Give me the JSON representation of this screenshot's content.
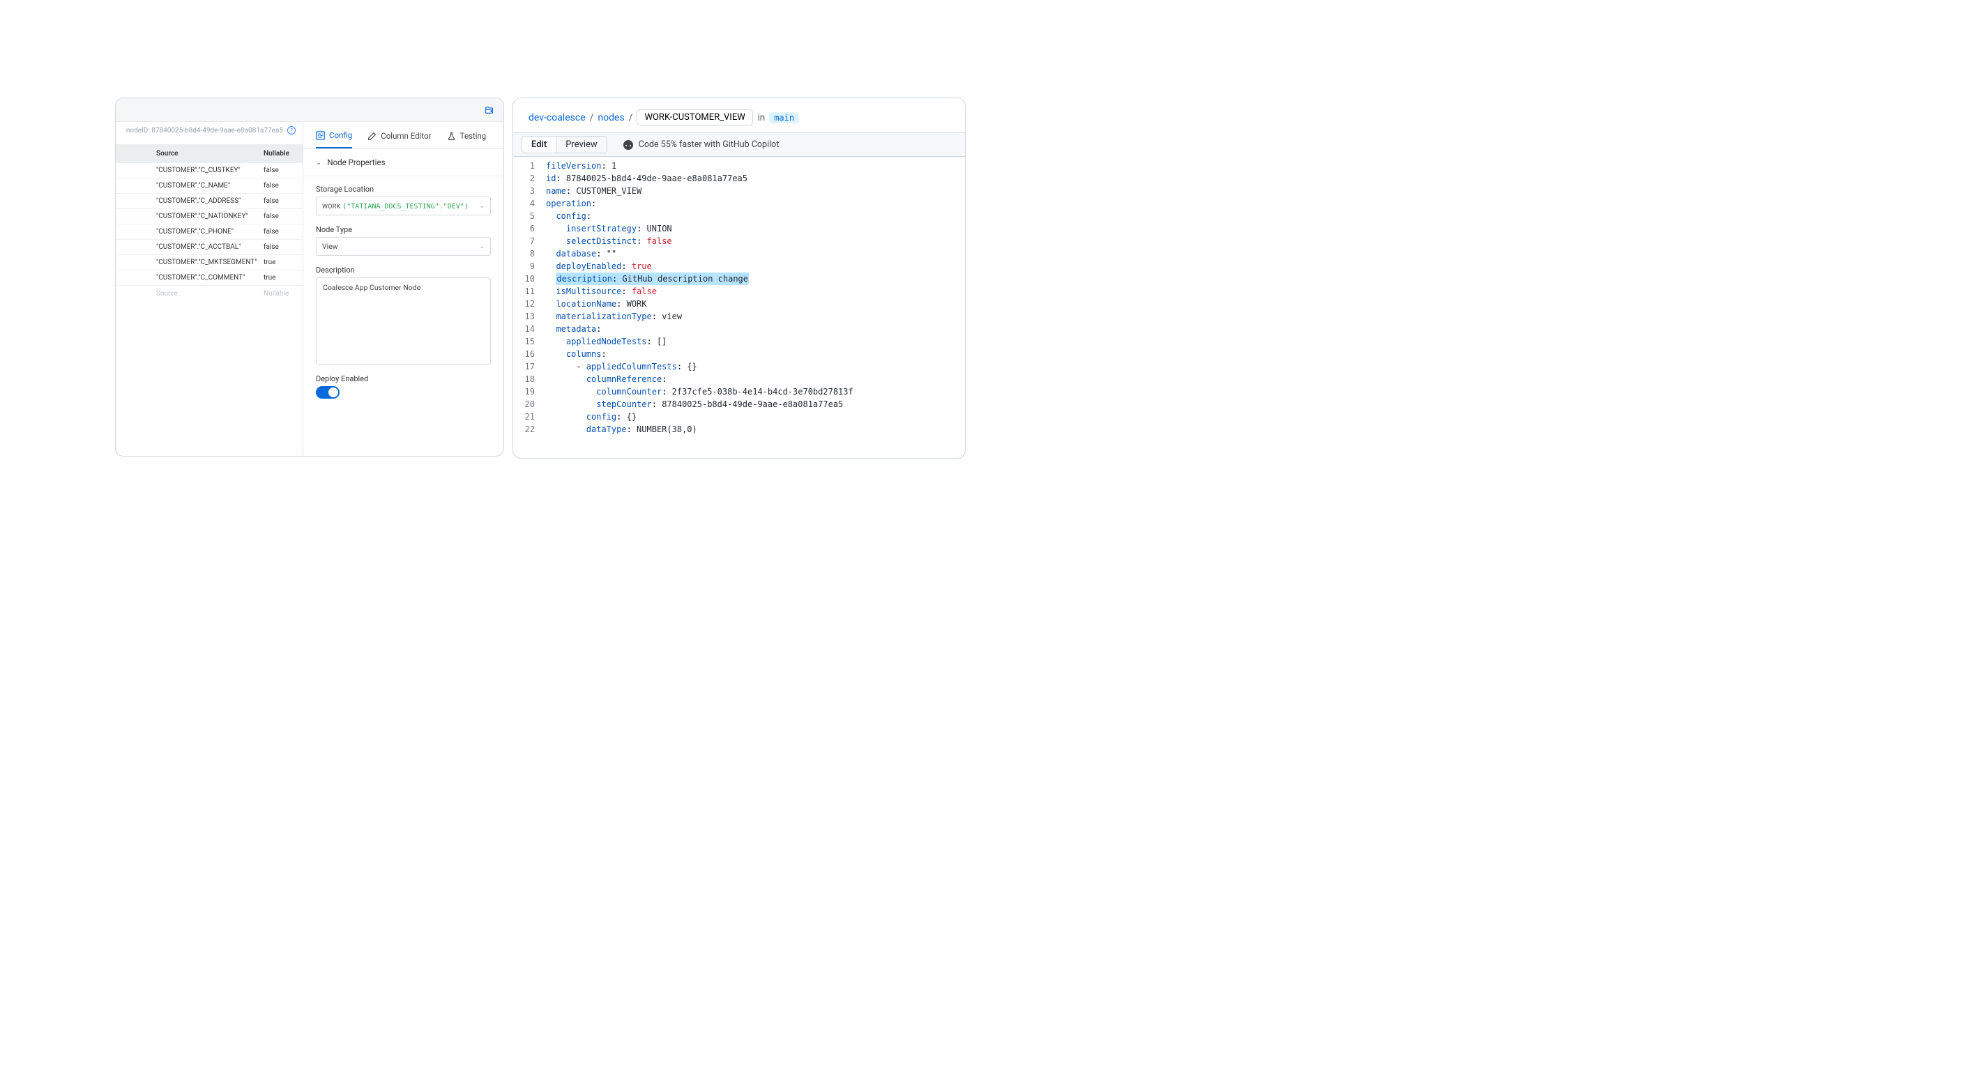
{
  "left": {
    "node_id": "nodeID: 87840025-b8d4-49de-9aae-e8a081a77ea5",
    "table": {
      "header_source": "Source",
      "header_nullable": "Nullable",
      "rows": [
        {
          "source": "\"CUSTOMER\".\"C_CUSTKEY\"",
          "nullable": "false"
        },
        {
          "source": "\"CUSTOMER\".\"C_NAME\"",
          "nullable": "false"
        },
        {
          "source": "\"CUSTOMER\".\"C_ADDRESS\"",
          "nullable": "false"
        },
        {
          "source": "\"CUSTOMER\".\"C_NATIONKEY\"",
          "nullable": "false"
        },
        {
          "source": "\"CUSTOMER\".\"C_PHONE\"",
          "nullable": "false"
        },
        {
          "source": "\"CUSTOMER\".\"C_ACCTBAL\"",
          "nullable": "false"
        },
        {
          "source": "\"CUSTOMER\".\"C_MKTSEGMENT\"",
          "nullable": "true"
        },
        {
          "source": "\"CUSTOMER\".\"C_COMMENT\"",
          "nullable": "true"
        }
      ],
      "footer_source": "Source",
      "footer_nullable": "Nullable"
    },
    "tabs": {
      "config": "Config",
      "column_editor": "Column Editor",
      "testing": "Testing"
    },
    "section_title": "Node Properties",
    "storage_label": "Storage Location",
    "storage_work": "WORK",
    "storage_path": "(\"TATIANA_DOCS_TESTING\".\"DEV\")",
    "node_type_label": "Node Type",
    "node_type_value": "View",
    "description_label": "Description",
    "description_value": "Coalesce App Customer Node",
    "deploy_label": "Deploy Enabled"
  },
  "right": {
    "breadcrumb": {
      "repo": "dev-coalesce",
      "folder": "nodes",
      "file": "WORK-CUSTOMER_VIEW",
      "in": "in",
      "branch": "main"
    },
    "toolbar": {
      "edit": "Edit",
      "preview": "Preview",
      "copilot": "Code 55% faster with GitHub Copilot"
    },
    "code": [
      {
        "n": 1,
        "indent": 0,
        "key": "fileVersion",
        "val": "1",
        "type": "n"
      },
      {
        "n": 2,
        "indent": 0,
        "key": "id",
        "val": "87840025-b8d4-49de-9aae-e8a081a77ea5",
        "type": "v"
      },
      {
        "n": 3,
        "indent": 0,
        "key": "name",
        "val": "CUSTOMER_VIEW",
        "type": "v"
      },
      {
        "n": 4,
        "indent": 0,
        "key": "operation",
        "val": "",
        "type": ""
      },
      {
        "n": 5,
        "indent": 1,
        "key": "config",
        "val": "",
        "type": ""
      },
      {
        "n": 6,
        "indent": 2,
        "key": "insertStrategy",
        "val": "UNION",
        "type": "v"
      },
      {
        "n": 7,
        "indent": 2,
        "key": "selectDistinct",
        "val": "false",
        "type": "b"
      },
      {
        "n": 8,
        "indent": 1,
        "key": "database",
        "val": "\"\"",
        "type": "v"
      },
      {
        "n": 9,
        "indent": 1,
        "key": "deployEnabled",
        "val": "true",
        "type": "b"
      },
      {
        "n": 10,
        "indent": 1,
        "key": "description",
        "val": "GitHub description change",
        "type": "v",
        "hl": true
      },
      {
        "n": 11,
        "indent": 1,
        "key": "isMultisource",
        "val": "false",
        "type": "b"
      },
      {
        "n": 12,
        "indent": 1,
        "key": "locationName",
        "val": "WORK",
        "type": "v"
      },
      {
        "n": 13,
        "indent": 1,
        "key": "materializationType",
        "val": "view",
        "type": "v"
      },
      {
        "n": 14,
        "indent": 1,
        "key": "metadata",
        "val": "",
        "type": ""
      },
      {
        "n": 15,
        "indent": 2,
        "key": "appliedNodeTests",
        "val": "[]",
        "type": "v"
      },
      {
        "n": 16,
        "indent": 2,
        "key": "columns",
        "val": "",
        "type": ""
      },
      {
        "n": 17,
        "indent": 3,
        "prefix": "- ",
        "key": "appliedColumnTests",
        "val": "{}",
        "type": "v"
      },
      {
        "n": 18,
        "indent": 4,
        "key": "columnReference",
        "val": "",
        "type": ""
      },
      {
        "n": 19,
        "indent": 5,
        "key": "columnCounter",
        "val": "2f37cfe5-038b-4e14-b4cd-3e70bd27813f",
        "type": "v"
      },
      {
        "n": 20,
        "indent": 5,
        "key": "stepCounter",
        "val": "87840025-b8d4-49de-9aae-e8a081a77ea5",
        "type": "v"
      },
      {
        "n": 21,
        "indent": 4,
        "key": "config",
        "val": "{}",
        "type": "v"
      },
      {
        "n": 22,
        "indent": 4,
        "key": "dataType",
        "val": "NUMBER(38,0)",
        "type": "v"
      }
    ]
  }
}
